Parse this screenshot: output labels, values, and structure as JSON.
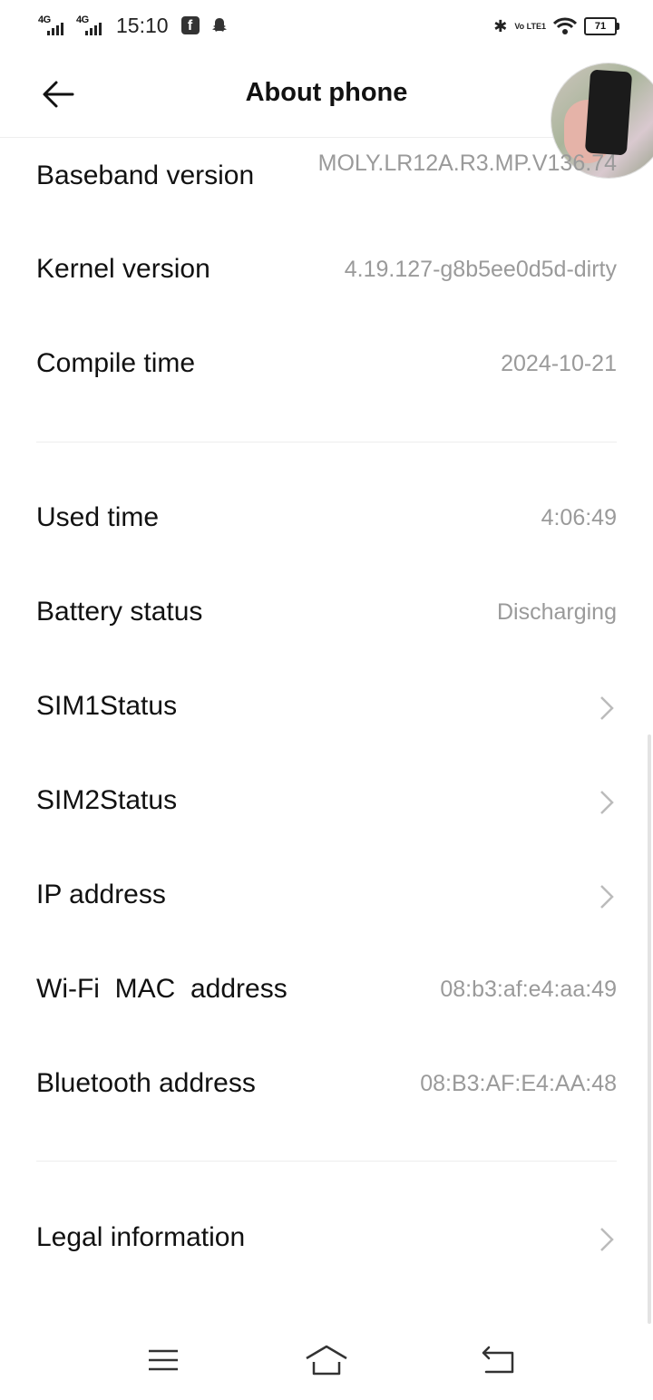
{
  "status_bar": {
    "sim1_network": "4G",
    "sim2_network": "4G",
    "time": "15:10",
    "volte_label": "Vo LTE1",
    "battery_level": "71"
  },
  "header": {
    "title": "About phone"
  },
  "rows": {
    "baseband": {
      "label": "Baseband version",
      "value": "MOLY.LR12A.R3.MP.V136.74"
    },
    "kernel": {
      "label": "Kernel version",
      "value": "4.19.127-g8b5ee0d5d-dirty"
    },
    "compile": {
      "label": "Compile time",
      "value": "2024-10-21"
    },
    "used_time": {
      "label": "Used time",
      "value": "4:06:49"
    },
    "battery": {
      "label": "Battery status",
      "value": "Discharging"
    },
    "sim1": {
      "label": "SIM1Status"
    },
    "sim2": {
      "label": "SIM2Status"
    },
    "ip": {
      "label": "IP address"
    },
    "wifi_mac": {
      "label": "Wi-Fi  MAC  address",
      "value": "08:b3:af:e4:aa:49"
    },
    "bt_address": {
      "label": "Bluetooth address",
      "value": "08:B3:AF:E4:AA:48"
    },
    "legal": {
      "label": "Legal information"
    }
  },
  "icons": {
    "back": "arrow-left-icon",
    "chevron": "chevron-right-icon",
    "nav_menu": "menu-icon",
    "nav_home": "home-icon",
    "nav_back": "return-icon"
  },
  "colors": {
    "primary_text": "#111111",
    "secondary_text": "#9a9a9a",
    "divider": "#ededed",
    "background": "#ffffff"
  }
}
